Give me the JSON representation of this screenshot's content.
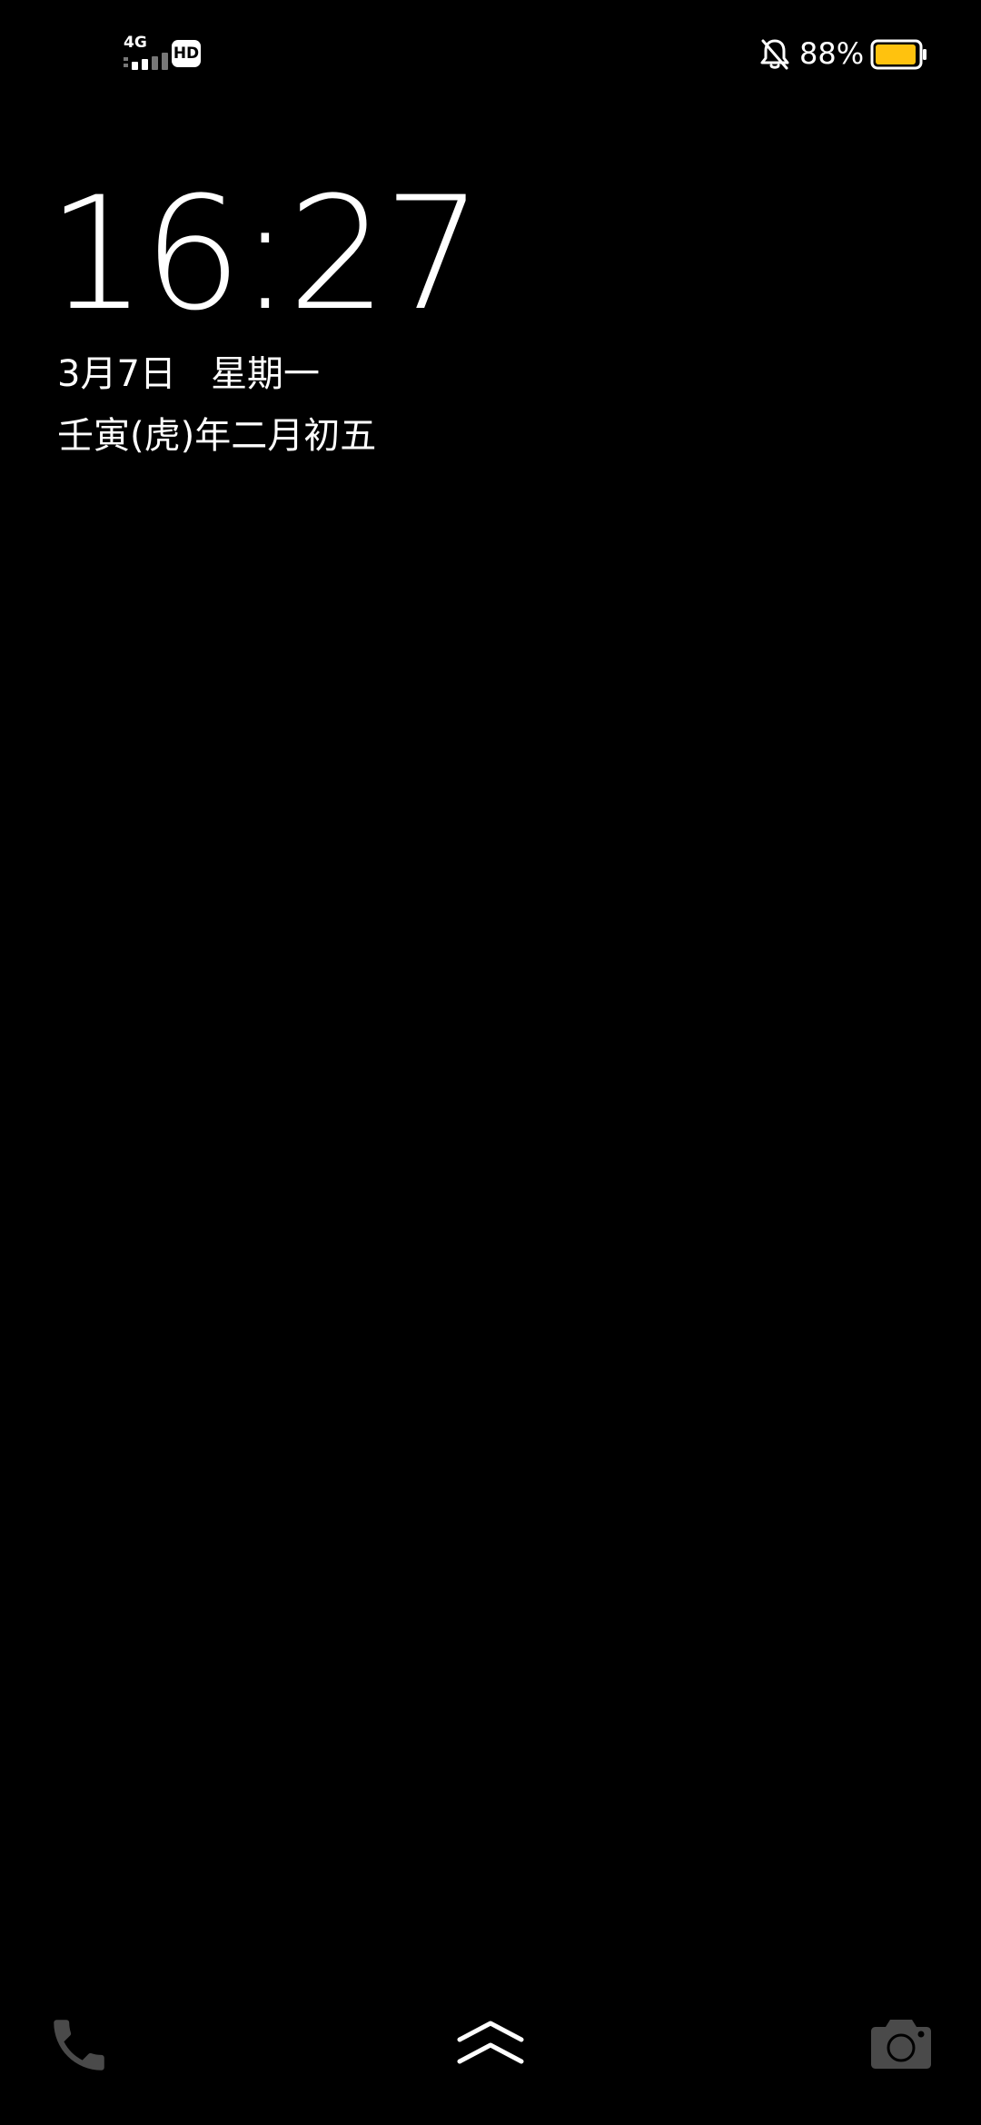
{
  "status_bar": {
    "network": "4G",
    "hd_label": "HD",
    "icons": [
      "signal-icon",
      "hd-icon",
      "bell-off-icon",
      "battery-icon"
    ],
    "battery_percent": "88%",
    "battery_level": 88,
    "battery_color": "#FFC20E"
  },
  "lock_screen": {
    "time": "16:27",
    "date": "3月7日",
    "weekday": "星期一",
    "lunar_date": "壬寅(虎)年二月初五"
  },
  "shortcuts": {
    "icons": [
      "phone-icon",
      "unlock-chevron-icon",
      "camera-icon"
    ],
    "icon_color": "#4A4A4A"
  }
}
